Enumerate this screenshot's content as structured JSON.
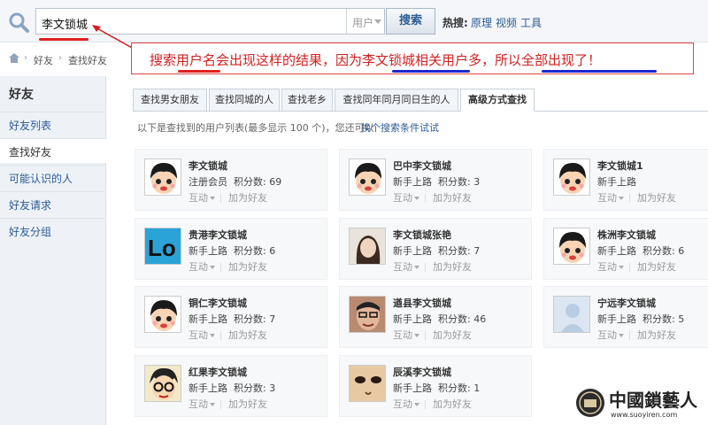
{
  "search": {
    "query": "李文锁城",
    "scope": "用户",
    "button": "搜索",
    "hot_label": "热搜:",
    "hot_links": [
      "原理",
      "视频",
      "工具"
    ]
  },
  "breadcrumb": {
    "items": [
      "好友",
      "查找好友"
    ],
    "sep": "›"
  },
  "annotation": {
    "text": "搜索用户名会出现这样的结果，因为李文锁城相关用户多，所以全部出现了！",
    "colors": {
      "text": "#d02020",
      "red_line": "#e02020",
      "blue_line": "#1a2ad0"
    }
  },
  "sidebar": {
    "title": "好友",
    "items": [
      {
        "label": "好友列表",
        "active": false
      },
      {
        "label": "查找好友",
        "active": true
      },
      {
        "label": "可能认识的人",
        "active": false
      },
      {
        "label": "好友请求",
        "active": false
      },
      {
        "label": "好友分组",
        "active": false
      }
    ]
  },
  "tabs": [
    {
      "label": "查找男女朋友",
      "active": false
    },
    {
      "label": "查找同城的人",
      "active": false
    },
    {
      "label": "查找老乡",
      "active": false
    },
    {
      "label": "查找同年同月同日生的人",
      "active": false
    },
    {
      "label": "高级方式查找",
      "active": true
    }
  ],
  "hint": {
    "text": "以下是查找到的用户列表(最多显示 100 个)，您还可以",
    "link": "换个搜索条件试试"
  },
  "card_labels": {
    "score": "积分数:",
    "interact": "互动",
    "add": "加为好友"
  },
  "users": [
    {
      "name": "李文锁城",
      "level": "注册会员",
      "score": "69",
      "avatar": "cartoon"
    },
    {
      "name": "巴中李文锁城",
      "level": "新手上路",
      "score": "3",
      "avatar": "cartoon"
    },
    {
      "name": "李文锁城1",
      "level": "新手上路",
      "score": "",
      "avatar": "cartoon"
    },
    {
      "name": "贵港李文锁城",
      "level": "新手上路",
      "score": "6",
      "avatar": "lo"
    },
    {
      "name": "李文锁城张艳",
      "level": "新手上路",
      "score": "7",
      "avatar": "photo-girl"
    },
    {
      "name": "株洲李文锁城",
      "level": "新手上路",
      "score": "6",
      "avatar": "cartoon"
    },
    {
      "name": "铜仁李文锁城",
      "level": "新手上路",
      "score": "7",
      "avatar": "cartoon"
    },
    {
      "name": "遒县李文锁城",
      "level": "新手上路",
      "score": "46",
      "avatar": "photo-man"
    },
    {
      "name": "宁远李文锁城",
      "level": "新手上路",
      "score": "5",
      "avatar": "default"
    },
    {
      "name": "红果李文锁城",
      "level": "新手上路",
      "score": "3",
      "avatar": "cartoon-glasses"
    },
    {
      "name": "辰溪李文锁城",
      "level": "新手上路",
      "score": "1",
      "avatar": "face-closeup"
    }
  ],
  "watermark": {
    "text": "中國鎖藝人",
    "url": "www.suoyiren.com",
    "badge": "锁艺人"
  }
}
